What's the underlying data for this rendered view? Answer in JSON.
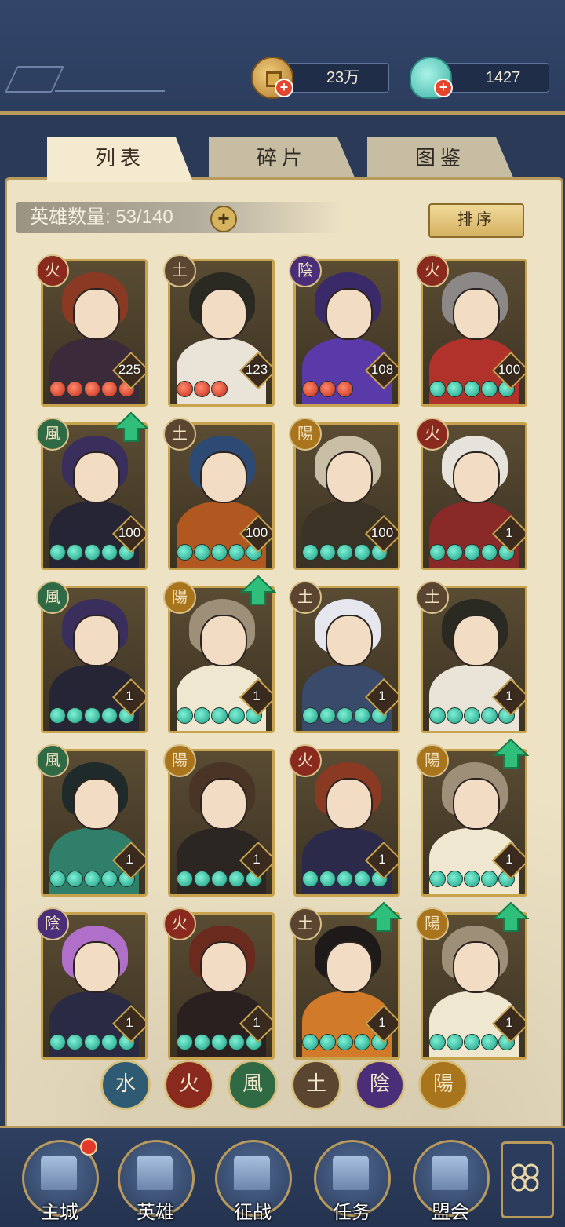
{
  "currency": {
    "coins": "23万",
    "jade": "1427"
  },
  "tabs": [
    {
      "label": "列表",
      "active": true
    },
    {
      "label": "碎片",
      "active": false
    },
    {
      "label": "图鉴",
      "active": false
    }
  ],
  "hero_count": "英雄数量: 53/140",
  "sort_label": "排序",
  "heroes": [
    {
      "element": "火",
      "level": "225",
      "stars": 5,
      "star_color": "red",
      "upgrade": false,
      "hair": "#8a3a23",
      "outfit": "#3a2a3a"
    },
    {
      "element": "土",
      "level": "123",
      "stars": 3,
      "star_color": "red",
      "upgrade": false,
      "hair": "#2b2a22",
      "outfit": "#e9e4d7"
    },
    {
      "element": "陰",
      "level": "108",
      "stars": 3,
      "star_color": "red",
      "upgrade": false,
      "hair": "#3b2a6a",
      "outfit": "#5a3aa8"
    },
    {
      "element": "火",
      "level": "100",
      "stars": 5,
      "star_color": "teal",
      "upgrade": false,
      "hair": "#8c8887",
      "outfit": "#b1322a"
    },
    {
      "element": "風",
      "level": "100",
      "stars": 5,
      "star_color": "teal",
      "upgrade": true,
      "hair": "#3a2f5c",
      "outfit": "#252535"
    },
    {
      "element": "土",
      "level": "100",
      "stars": 5,
      "star_color": "teal",
      "upgrade": false,
      "hair": "#2c4a73",
      "outfit": "#b0581f"
    },
    {
      "element": "陽",
      "level": "100",
      "stars": 5,
      "star_color": "teal",
      "upgrade": false,
      "hair": "#c9bea6",
      "outfit": "#3b3226"
    },
    {
      "element": "火",
      "level": "1",
      "stars": 5,
      "star_color": "teal",
      "upgrade": false,
      "hair": "#e6e2dc",
      "outfit": "#8a2a28"
    },
    {
      "element": "風",
      "level": "1",
      "stars": 5,
      "star_color": "teal",
      "upgrade": false,
      "hair": "#3a2f5c",
      "outfit": "#252535"
    },
    {
      "element": "陽",
      "level": "1",
      "stars": 5,
      "star_color": "teal",
      "upgrade": true,
      "hair": "#9d8f78",
      "outfit": "#efe7cf"
    },
    {
      "element": "土",
      "level": "1",
      "stars": 5,
      "star_color": "teal",
      "upgrade": false,
      "hair": "#e6e6ef",
      "outfit": "#3a4a6a"
    },
    {
      "element": "土",
      "level": "1",
      "stars": 5,
      "star_color": "teal",
      "upgrade": false,
      "hair": "#2b2a22",
      "outfit": "#e9e4d7"
    },
    {
      "element": "風",
      "level": "1",
      "stars": 5,
      "star_color": "teal",
      "upgrade": false,
      "hair": "#1f2a2a",
      "outfit": "#2f7f6a"
    },
    {
      "element": "陽",
      "level": "1",
      "stars": 5,
      "star_color": "teal",
      "upgrade": false,
      "hair": "#4a3426",
      "outfit": "#2b2622"
    },
    {
      "element": "火",
      "level": "1",
      "stars": 5,
      "star_color": "teal",
      "upgrade": false,
      "hair": "#8a3a23",
      "outfit": "#2c2a4a"
    },
    {
      "element": "陽",
      "level": "1",
      "stars": 5,
      "star_color": "teal",
      "upgrade": true,
      "hair": "#9d8f78",
      "outfit": "#efe7cf"
    },
    {
      "element": "陰",
      "level": "1",
      "stars": 5,
      "star_color": "teal",
      "upgrade": false,
      "hair": "#b06fc9",
      "outfit": "#2b2a45"
    },
    {
      "element": "火",
      "level": "1",
      "stars": 5,
      "star_color": "teal",
      "upgrade": false,
      "hair": "#6a2a1e",
      "outfit": "#2a2020"
    },
    {
      "element": "土",
      "level": "1",
      "stars": 5,
      "star_color": "teal",
      "upgrade": true,
      "hair": "#1f1a1a",
      "outfit": "#d07a2a"
    },
    {
      "element": "陽",
      "level": "1",
      "stars": 5,
      "star_color": "teal",
      "upgrade": true,
      "hair": "#9d8f78",
      "outfit": "#efe7cf"
    }
  ],
  "element_colors": {
    "水": "#2f5a73",
    "火": "#8a2a1e",
    "風": "#2f6a45",
    "土": "#5a4630",
    "陰": "#4a2f78",
    "陽": "#a8741c"
  },
  "filters": [
    "水",
    "火",
    "風",
    "土",
    "陰",
    "陽"
  ],
  "nav": [
    {
      "label": "主城",
      "icon": "palace-icon",
      "badge": true
    },
    {
      "label": "英雄",
      "icon": "hero-icon",
      "badge": false
    },
    {
      "label": "征战",
      "icon": "battle-icon",
      "badge": false
    },
    {
      "label": "任务",
      "icon": "scroll-icon",
      "badge": false
    },
    {
      "label": "盟会",
      "icon": "alliance-icon",
      "badge": false
    }
  ]
}
